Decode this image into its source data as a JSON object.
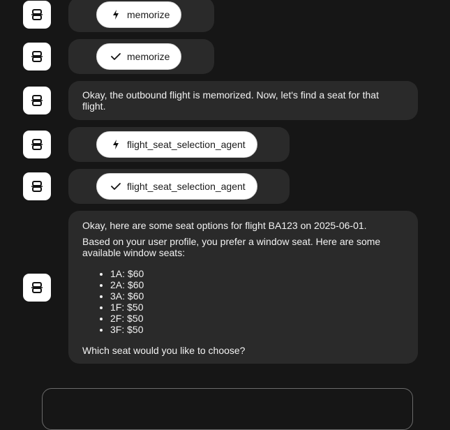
{
  "messages": [
    {
      "type": "tool",
      "status": "running",
      "status_icon": "bolt-icon",
      "label": "memorize"
    },
    {
      "type": "tool",
      "status": "done",
      "status_icon": "check-icon",
      "label": "memorize"
    },
    {
      "type": "text",
      "text": "Okay, the outbound flight is memorized. Now, let's find a seat for that flight."
    },
    {
      "type": "tool",
      "status": "running",
      "status_icon": "bolt-icon",
      "label": "flight_seat_selection_agent"
    },
    {
      "type": "tool",
      "status": "done",
      "status_icon": "check-icon",
      "label": "flight_seat_selection_agent"
    },
    {
      "type": "rich",
      "intro": "Okay, here are some seat options for flight BA123 on 2025-06-01.",
      "body": "Based on your user profile, you prefer a window seat. Here are some available window seats:",
      "seats": [
        "1A: $60",
        "2A: $60",
        "3A: $60",
        "1F: $50",
        "2F: $50",
        "3F: $50"
      ],
      "question": "Which seat would you like to choose?"
    }
  ],
  "avatar_icon": "robot-icon",
  "composer": {
    "placeholder": ""
  },
  "colors": {
    "background": "#161616",
    "bubble": "#2a2a2a",
    "pill": "#ffffff",
    "avatar": "#ffffff"
  }
}
